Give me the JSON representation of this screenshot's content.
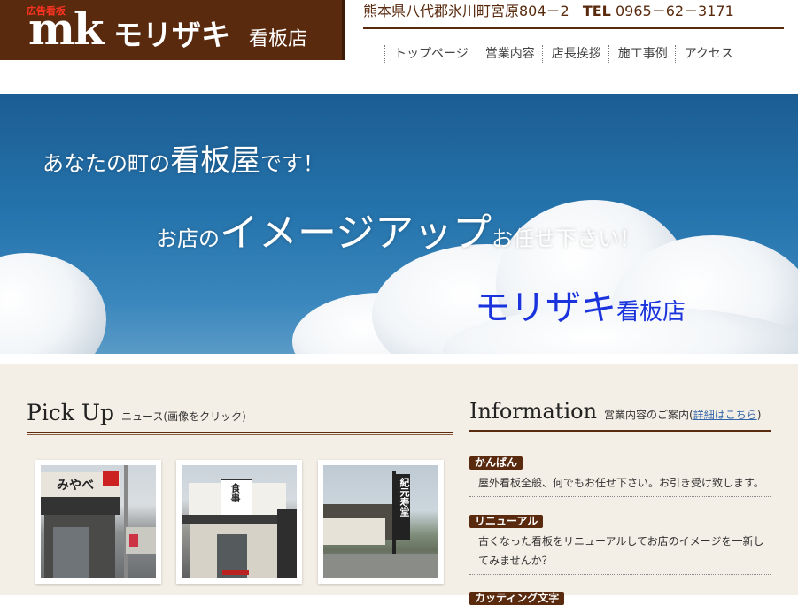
{
  "header": {
    "logo": {
      "tag": "広告看板",
      "mark": "mk",
      "name": "モリザキ",
      "shop": "看板店"
    },
    "address": "熊本県八代郡氷川町宮原804－2",
    "tel_label": "TEL",
    "tel": "0965－62－3171"
  },
  "nav": {
    "items": [
      "トップページ",
      "営業内容",
      "店長挨拶",
      "施工事例",
      "アクセス"
    ]
  },
  "hero": {
    "line1_pre": "あなたの町の",
    "line1_big": "看板屋",
    "line1_post": "です！",
    "line2_pre": "お店の",
    "line2_big": "イメージアップ",
    "line2_post": "お任せ下さい！",
    "line3_big": "モリザキ",
    "line3_post": "看板店"
  },
  "pickup": {
    "title": "Pick Up",
    "subtitle": "ニュース(画像をクリック)",
    "photos": [
      {
        "sign": "みやべ"
      },
      {
        "sign": "食事"
      },
      {
        "sign": "紀元寿堂"
      }
    ]
  },
  "information": {
    "title": "Information",
    "subtitle_pre": "営業内容のご案内(",
    "subtitle_link": "詳細はこちら",
    "subtitle_post": ")",
    "items": [
      {
        "label": "かんばん",
        "text": "屋外看板全般、何でもお任せ下さい。お引き受け致します。"
      },
      {
        "label": "リニューアル",
        "text": "古くなった看板をリニューアルしてお店のイメージを一新してみませんか？"
      },
      {
        "label": "カッティング文字",
        "text": ""
      }
    ]
  },
  "colors": {
    "brand": "#5a2a0e",
    "sky": "#2573ac",
    "accent_blue": "#1a33dd",
    "content_bg": "#f4efe6"
  }
}
